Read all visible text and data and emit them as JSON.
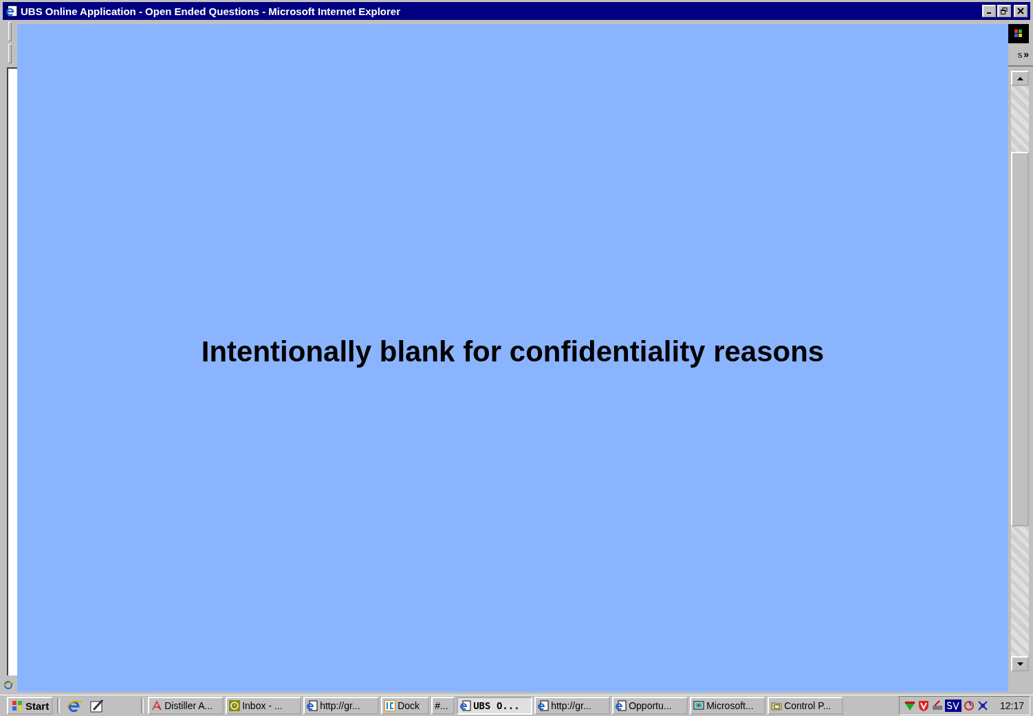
{
  "window": {
    "title": "UBS Online Application - Open Ended Questions - Microsoft Internet Explorer"
  },
  "toolbar": {
    "cut_text": "s",
    "chevron": "»"
  },
  "page": {
    "notice": "Intentionally blank for confidentiality reasons"
  },
  "taskbar": {
    "start": "Start",
    "tasks": [
      {
        "label": "Distiller A...",
        "kind": "distiller",
        "selected": false
      },
      {
        "label": "Inbox - ...",
        "kind": "mail",
        "selected": false
      },
      {
        "label": "http://gr...",
        "kind": "browser",
        "selected": false
      },
      {
        "label": "Dock",
        "kind": "ic",
        "selected": false
      },
      {
        "label": "#...",
        "kind": "none",
        "selected": false
      },
      {
        "label": "UBS O...",
        "kind": "browser",
        "selected": true
      },
      {
        "label": "http://gr...",
        "kind": "browser",
        "selected": false
      },
      {
        "label": "Opportu...",
        "kind": "browser",
        "selected": false
      },
      {
        "label": "Microsoft...",
        "kind": "screen",
        "selected": false
      },
      {
        "label": "Control P...",
        "kind": "folder",
        "selected": false
      }
    ],
    "clock": "12:17"
  }
}
